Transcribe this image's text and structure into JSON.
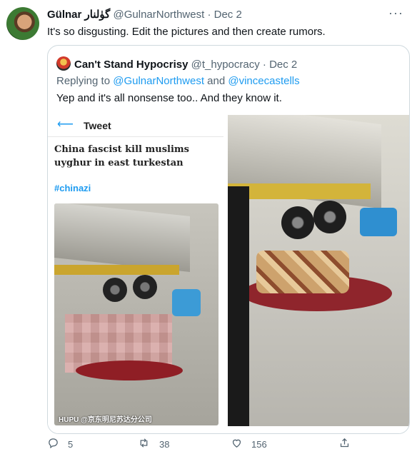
{
  "tweet": {
    "author_name": "Gülnar گۈلنار",
    "handle": "@GulnarNorthwest",
    "separator": "·",
    "date": "Dec 2",
    "text": "It's so disgusting. Edit the pictures and then create rumors.",
    "more_icon": "more-icon"
  },
  "quote": {
    "author_name": "Can't Stand Hypocrisy",
    "handle": "@t_hypocracy",
    "date": "Dec 2",
    "reply_prefix": "Replying to",
    "reply_user1": "@GulnarNorthwest",
    "reply_and": "and",
    "reply_user2": "@vincecastells",
    "text": "Yep and it's all nonsense too.. And they know it.",
    "embedded_screenshot": {
      "header_title": "Tweet",
      "text": "China fascist kill muslims uyghur in east turkestan",
      "hashtag": "#chinazi",
      "watermark": "HUPU @京东明尼苏达分公司"
    }
  },
  "actions": {
    "reply_count": "5",
    "retweet_count": "38",
    "like_count": "156"
  },
  "colors": {
    "link": "#1d9bf0",
    "muted": "#536471",
    "border": "#cfd9de"
  }
}
